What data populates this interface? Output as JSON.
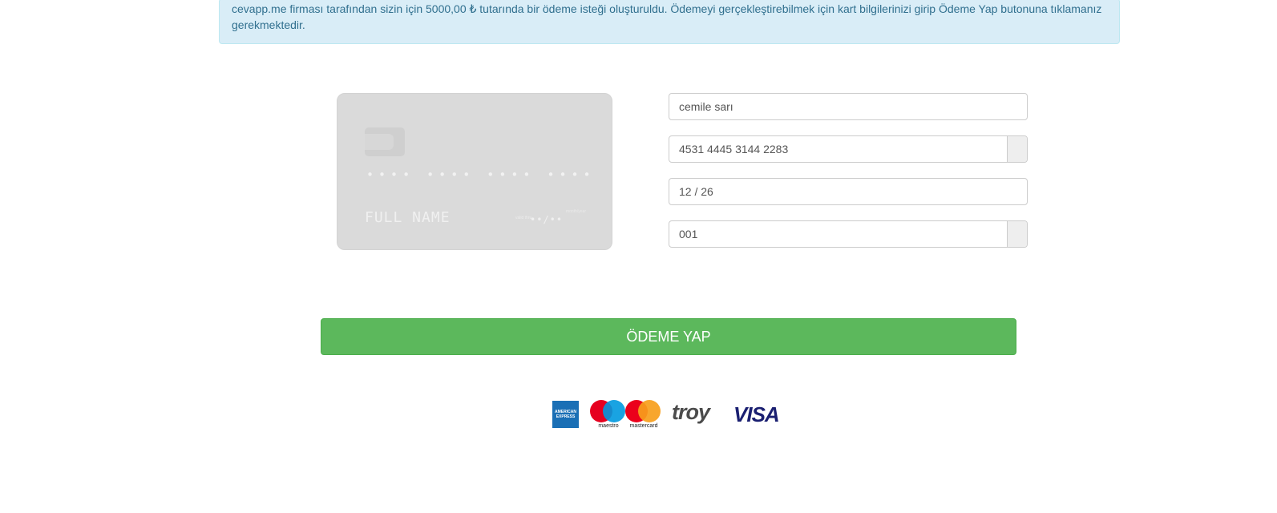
{
  "alert": {
    "text": "cevapp.me firması tarafından sizin için 5000,00 ₺ tutarında bir ödeme isteği oluşturuldu. Ödemeyi gerçekleştirebilmek için kart bilgilerinizi girip Ödeme Yap butonuna tıklamanız gerekmektedir."
  },
  "card_preview": {
    "number_mask": "•••• •••• •••• ••••",
    "name_placeholder": "FULL NAME",
    "expiry_label": "month/year",
    "expiry_side": "valid thru",
    "expiry_mask": "••/••"
  },
  "form": {
    "name_value": "cemile sarı",
    "number_value": "4531 4445 3144 2283",
    "expiry_value": "12 / 26",
    "cvc_value": "001"
  },
  "pay_button": {
    "label": "ÖDEME YAP"
  },
  "logos": {
    "amex_text": "AMERICAN EXPRESS",
    "maestro_text": "maestro",
    "mastercard_text": "mastercard",
    "troy_text": "troy",
    "visa_text": "VISA"
  },
  "colors": {
    "pay_button": "#5cb85c",
    "alert_bg": "#d9edf7",
    "alert_text": "#31708f"
  }
}
